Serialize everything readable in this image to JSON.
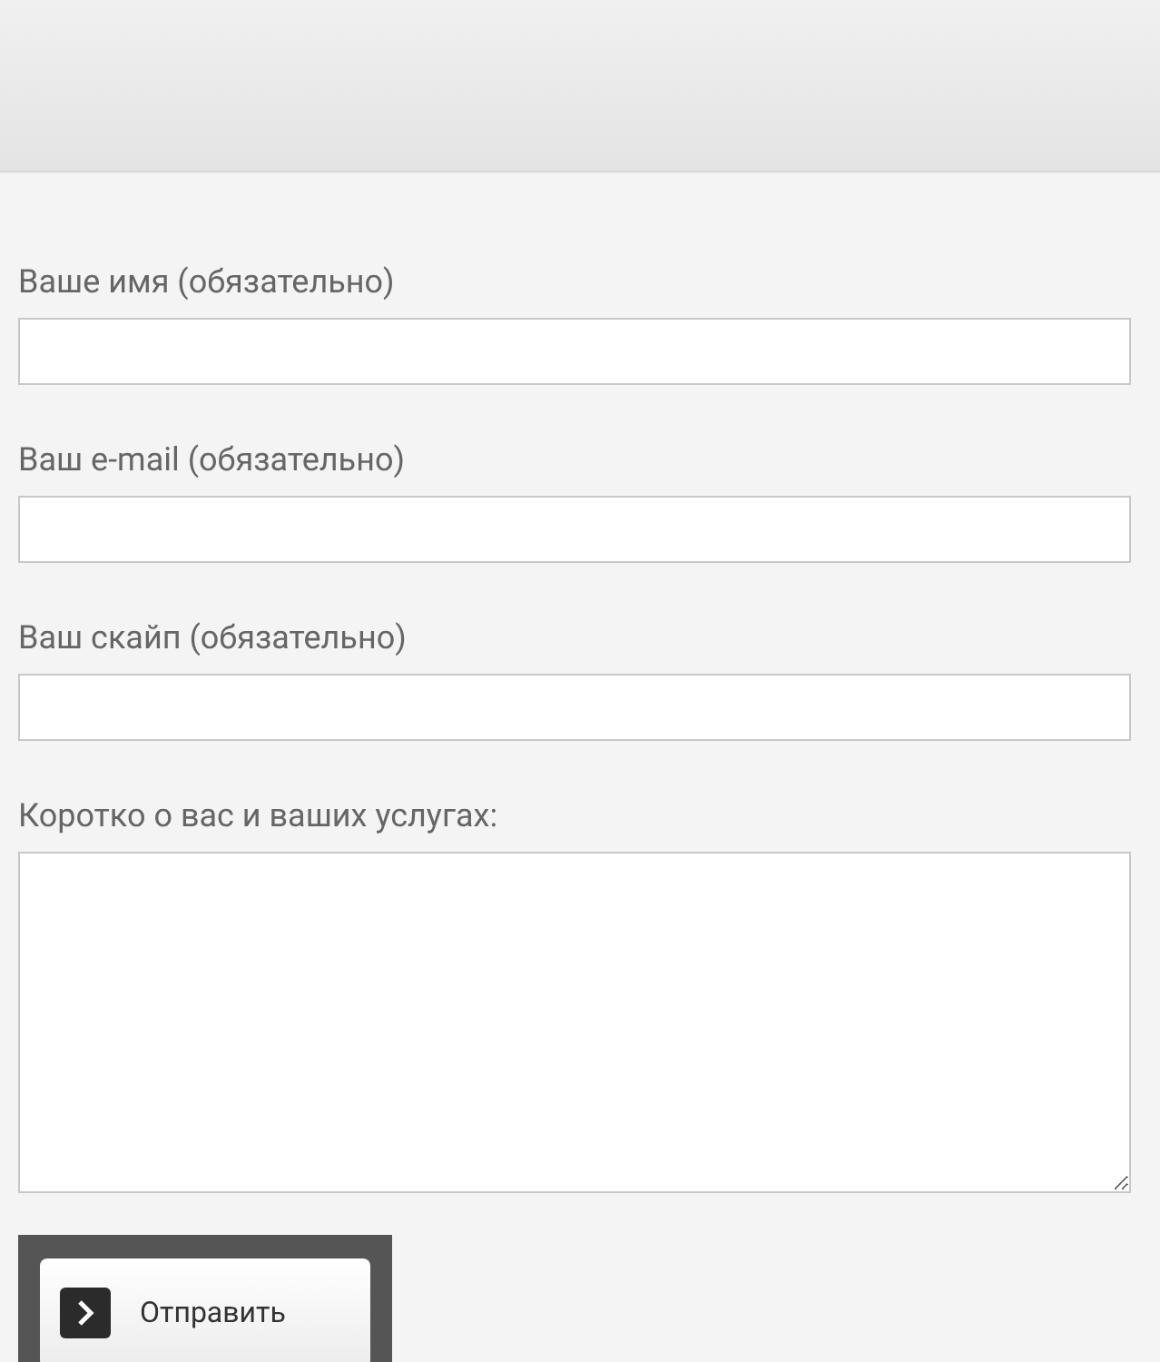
{
  "form": {
    "fields": [
      {
        "kind": "input",
        "label": "Ваше имя (обязательно)"
      },
      {
        "kind": "input",
        "label": "Ваш e-mail (обязательно)"
      },
      {
        "kind": "input",
        "label": "Ваш скайп (обязательно)"
      },
      {
        "kind": "textarea",
        "label": "Коротко о вас и ваших услугах:"
      }
    ],
    "submit": {
      "label": "Отправить"
    }
  }
}
